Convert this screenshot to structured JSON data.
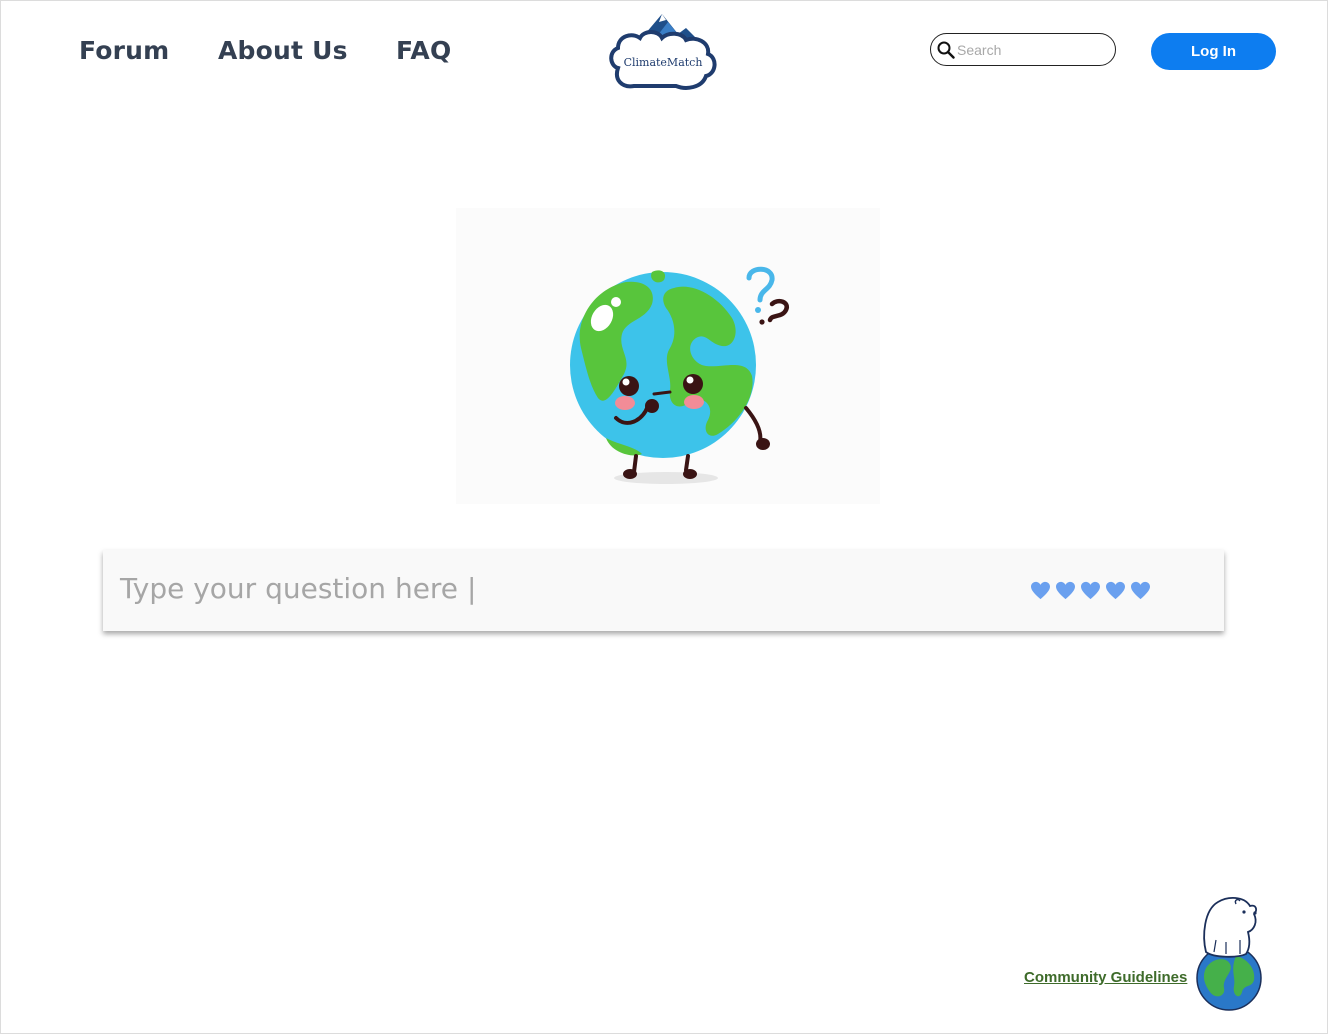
{
  "nav": {
    "items": [
      {
        "label": "Forum"
      },
      {
        "label": "About Us"
      },
      {
        "label": "FAQ"
      }
    ]
  },
  "logo": {
    "text": "ClimateMatch",
    "icon": "mountain-cloud-logo"
  },
  "search": {
    "placeholder": "Search",
    "value": ""
  },
  "login": {
    "label": "Log In"
  },
  "hero": {
    "icon": "confused-earth-mascot-image"
  },
  "question": {
    "placeholder": "Type your question here |",
    "hearts_count": 5,
    "heart_color": "#6aa0ef"
  },
  "footer": {
    "guidelines_link": "Community Guidelines",
    "icon": "polar-bear-on-globe-image"
  },
  "colors": {
    "accent": "#0d7df0",
    "nav_text": "#344052",
    "link_green": "#3e6b2a"
  }
}
